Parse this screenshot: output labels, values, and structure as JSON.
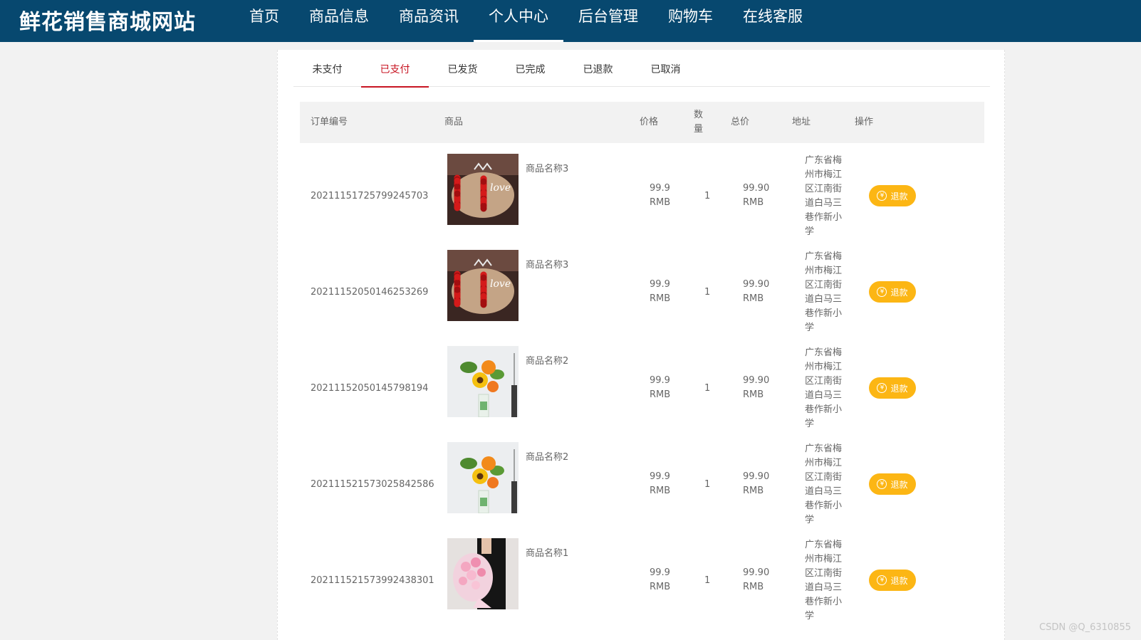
{
  "header": {
    "site_title": "鲜花销售商城网站",
    "nav": [
      "首页",
      "商品信息",
      "商品资讯",
      "个人中心",
      "后台管理",
      "购物车",
      "在线客服"
    ],
    "active_nav": "个人中心"
  },
  "tabs": {
    "items": [
      "未支付",
      "已支付",
      "已发货",
      "已完成",
      "已退款",
      "已取消"
    ],
    "active": "已支付"
  },
  "table": {
    "headers": {
      "order_no": "订单编号",
      "goods": "商品",
      "price": "价格",
      "qty": "数量",
      "total": "总价",
      "address": "地址",
      "action": "操作"
    },
    "rows": [
      {
        "order_no": "20211151725799245703",
        "image": "roses-bouquet",
        "name": "商品名称3",
        "price": "99.9 RMB",
        "qty": "1",
        "total": "99.90 RMB",
        "address": "广东省梅州市梅江区江南街道白马三巷作新小学",
        "action": "退款"
      },
      {
        "order_no": "20211152050146253269",
        "image": "roses-bouquet",
        "name": "商品名称3",
        "price": "99.9 RMB",
        "qty": "1",
        "total": "99.90 RMB",
        "address": "广东省梅州市梅江区江南街道白马三巷作新小学",
        "action": "退款"
      },
      {
        "order_no": "20211152050145798194",
        "image": "sunflower-vase",
        "name": "商品名称2",
        "price": "99.9 RMB",
        "qty": "1",
        "total": "99.90 RMB",
        "address": "广东省梅州市梅江区江南街道白马三巷作新小学",
        "action": "退款"
      },
      {
        "order_no": "20211152157302584258​6",
        "image": "sunflower-vase",
        "name": "商品名称2",
        "price": "99.9 RMB",
        "qty": "1",
        "total": "99.90 RMB",
        "address": "广东省梅州市梅江区江南街道白马三巷作新小学",
        "action": "退款"
      },
      {
        "order_no": "20211152157399243830​1",
        "image": "pink-bouquet",
        "name": "商品名称1",
        "price": "99.9 RMB",
        "qty": "1",
        "total": "99.90 RMB",
        "address": "广东省梅州市梅江区江南街道白马三巷作新小学",
        "action": "退款"
      }
    ]
  },
  "watermark": "CSDN @Q_6310855",
  "colors": {
    "nav_bg": "#07486f",
    "tab_active": "#c81623",
    "refund_btn": "#fcb614"
  }
}
